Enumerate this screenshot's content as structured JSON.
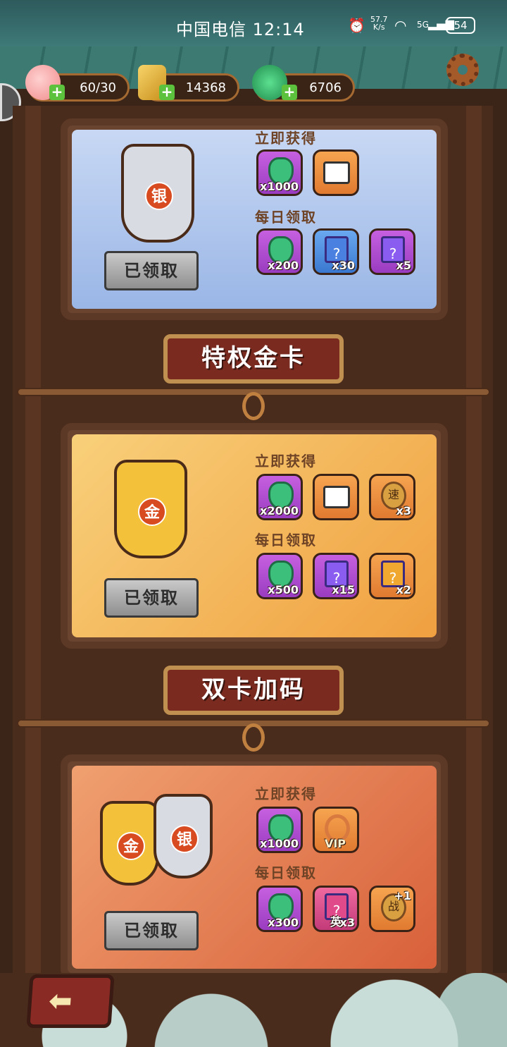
{
  "status_bar": {
    "carrier_time": "中国电信 12:14",
    "net_speed_top": "57.7",
    "net_speed_unit": "K/s",
    "signal": "5G",
    "battery": "54"
  },
  "resources": {
    "stamina": "60/30",
    "gold": "14368",
    "jade": "6706"
  },
  "cards": [
    {
      "tag_char": "银",
      "instant_label": "立即获得",
      "daily_label": "每日领取",
      "instant_items": [
        {
          "icon": "jade",
          "qty": "x1000"
        },
        {
          "icon": "ad-free-tv",
          "qty": ""
        }
      ],
      "daily_items": [
        {
          "icon": "jade",
          "qty": "x200"
        },
        {
          "icon": "blue-card",
          "qty": "x30"
        },
        {
          "icon": "purple-card",
          "qty": "x5"
        }
      ],
      "button": "已领取"
    },
    {
      "banner": "特权金卡",
      "tag_char": "金",
      "instant_label": "立即获得",
      "daily_label": "每日领取",
      "instant_items": [
        {
          "icon": "jade",
          "qty": "x2000"
        },
        {
          "icon": "ad-free-tv",
          "qty": ""
        },
        {
          "icon": "speed",
          "qty": "x3",
          "glyph": "速"
        }
      ],
      "daily_items": [
        {
          "icon": "jade",
          "qty": "x500"
        },
        {
          "icon": "purple-card",
          "qty": "x15"
        },
        {
          "icon": "gold-card",
          "qty": "x2"
        }
      ],
      "button": "已领取"
    },
    {
      "banner": "双卡加码",
      "tag_chars": [
        "金",
        "银"
      ],
      "instant_label": "立即获得",
      "daily_label": "每日领取",
      "instant_items": [
        {
          "icon": "jade",
          "qty": "x1000"
        },
        {
          "icon": "vip-ring",
          "qty": "",
          "glyph": "VIP"
        }
      ],
      "daily_items": [
        {
          "icon": "jade",
          "qty": "x300"
        },
        {
          "icon": "hero-card",
          "qty": "x3",
          "glyph": "英"
        },
        {
          "icon": "battle-badge",
          "qty": "+1",
          "glyph": "战"
        }
      ],
      "button": "已领取"
    }
  ]
}
